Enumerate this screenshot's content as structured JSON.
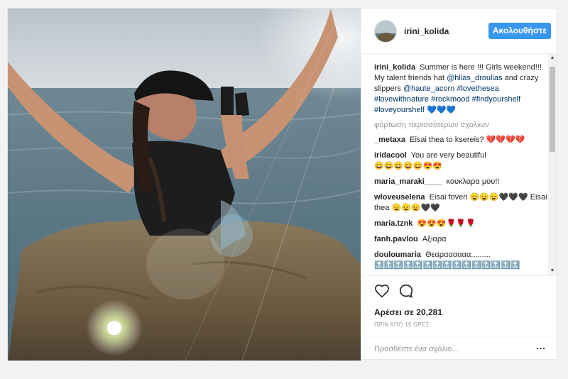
{
  "post": {
    "username": "irini_kolida",
    "follow_label": "Ακολουθήστε",
    "caption_user": "irini_kolida",
    "caption_text": "Summer is here !!! Girls weekend!!!",
    "caption_line2_a": "My talent friends hat",
    "caption_mention1": "@hlias_droulias",
    "caption_line2_b": "and crazy slippers",
    "caption_mention2": "@haute_acorn",
    "caption_tags": "#lovethesea #lovewithnature #rockmood #findyourshelf #loveyourshelf",
    "caption_emoji": "💙💙💙",
    "load_more": "φόρτωση περισσότερων σχολίων",
    "likes": "Αρέσει σε 20,281",
    "time_ago": "ΠΡΙΝ ΑΠΟ 15 ΩΡΕΣ",
    "add_comment_placeholder": "Προσθέστε ένα σχόλιο...",
    "more_options": "..."
  },
  "comments": [
    {
      "user": "_metaxa",
      "text": "Eisai thea to ksereis?",
      "emoji": "💔💔💔💔"
    },
    {
      "user": "iridacool",
      "text": "You are very beautiful",
      "emoji": "😄😄😄😄😄😍😍"
    },
    {
      "user": "maria_maraki____",
      "text": "κουκλαρα μου!!",
      "emoji": ""
    },
    {
      "user": "wloveuselena",
      "text": "Eisai foveri",
      "emoji": "😦😦😦🖤🖤🖤",
      "text2": "Eisai thea",
      "emoji2": "😦😦😦🖤🖤"
    },
    {
      "user": "maria.tznk",
      "text": "",
      "emoji": "😍😍😍🌹🌹🌹"
    },
    {
      "user": "fanh.pavlou",
      "text": "Αξιαρα",
      "emoji": ""
    },
    {
      "user": "douloumaria",
      "text": "Θεαραααααα.........",
      "emoji": "🔝🔝🔝🔝🔝🔝🔝🔝🔝🔝🔝🔝🔝🔝🔝"
    }
  ],
  "colors": {
    "accent": "#3897f0",
    "text": "#262626",
    "muted": "#999999",
    "hashtag": "#003569"
  },
  "icons": {
    "like": "heart-outline-icon",
    "comment": "speech-bubble-icon"
  }
}
